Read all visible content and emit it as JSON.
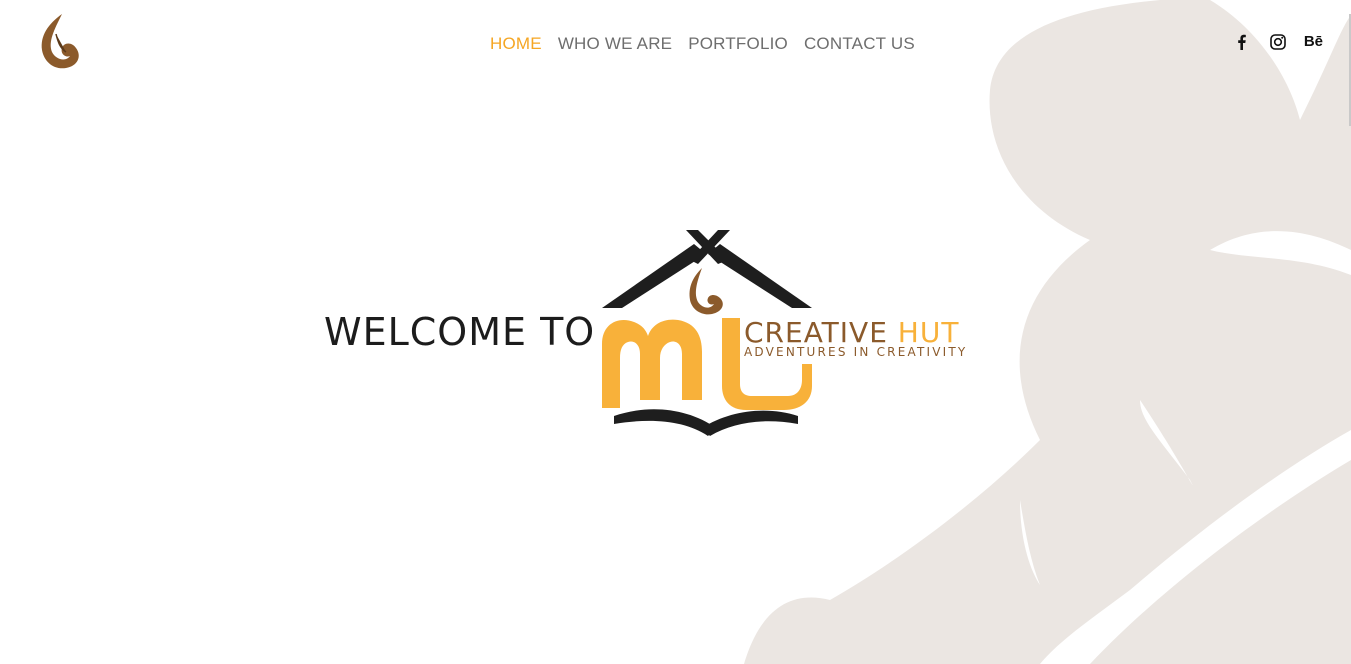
{
  "nav": {
    "items": [
      {
        "label": "HOME",
        "active": true
      },
      {
        "label": "WHO WE ARE",
        "active": false
      },
      {
        "label": "PORTFOLIO",
        "active": false
      },
      {
        "label": "CONTACT US",
        "active": false
      }
    ]
  },
  "social": {
    "icons": [
      "facebook-icon",
      "instagram-icon",
      "behance-icon"
    ],
    "behance_label": "Bē"
  },
  "hero": {
    "welcome": "WELCOME TO",
    "logo_brand": "CREATIVE HUT",
    "logo_tagline": "ADVENTURES IN CREATIVITY"
  },
  "colors": {
    "accent": "#f5a623",
    "nav_text": "#6e6e6e",
    "heading": "#1c1c1c",
    "brown": "#8b5a2b",
    "leaf_bg": "#ebe6e2"
  }
}
